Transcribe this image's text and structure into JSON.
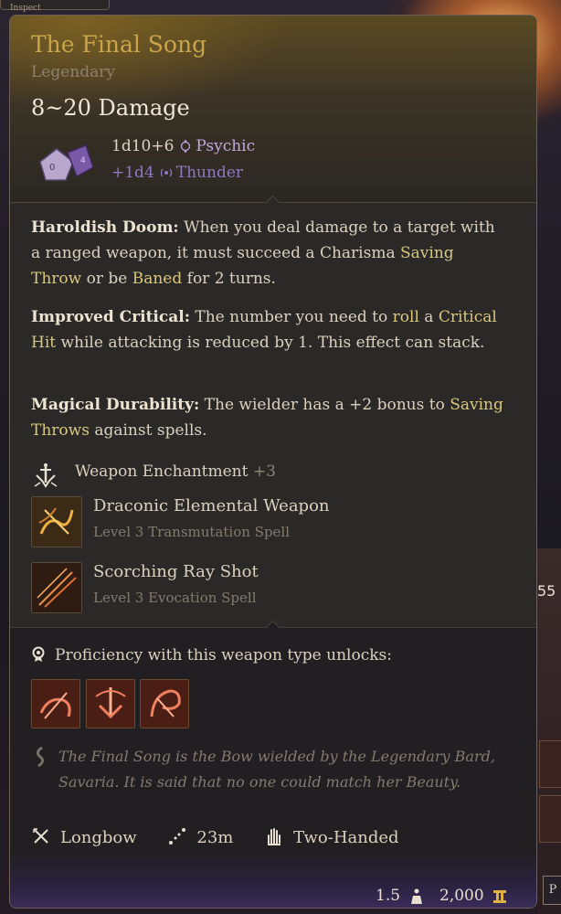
{
  "top_tab": {
    "label": "Inspect"
  },
  "side": {
    "number": "55",
    "bottom_button": "P"
  },
  "item": {
    "name": "The Final Song",
    "rarity": "Legendary",
    "damage": "8~20 Damage",
    "dice": [
      {
        "dice": "1d10+6",
        "type": "Psychic",
        "color": "#c6a8de"
      },
      {
        "dice": "+1d4",
        "type": "Thunder",
        "color": "#8f78c2"
      }
    ]
  },
  "passives": [
    {
      "name": "Haroldish Doom:",
      "t1": " When you deal damage to a target with a ranged weapon, it must succeed a Charisma ",
      "kw1": "Saving Throw",
      "t2": " or be ",
      "kw2": "Baned",
      "t3": " for 2 turns."
    },
    {
      "name": "Improved Critical:",
      "t1": " The number you need to ",
      "kw1": "roll",
      "t2": " a ",
      "kw2": "Critical Hit",
      "t3": " while attacking is reduced by 1. This effect can stack."
    },
    {
      "name": "Magical Durability:",
      "t1": " The wielder has a +2 bonus to ",
      "kw1": "Saving Throws",
      "t2": " against spells.",
      "kw2": "",
      "t3": ""
    }
  ],
  "enchantment": {
    "label": "Weapon Enchantment",
    "bonus": "+3"
  },
  "spells": [
    {
      "name": "Draconic Elemental Weapon",
      "sub": "Level 3 Transmutation Spell"
    },
    {
      "name": "Scorching Ray Shot",
      "sub": "Level 3 Evocation Spell"
    }
  ],
  "proficiency": {
    "label": "Proficiency with this weapon type unlocks:",
    "actions": [
      "action-1",
      "action-2",
      "action-3"
    ]
  },
  "flavor": "The Final Song is the Bow wielded by the Legendary Bard, Savaria. It is said that no one could match her Beauty.",
  "properties": [
    {
      "icon": "longbow-icon",
      "label": "Longbow"
    },
    {
      "icon": "range-icon",
      "label": "23m"
    },
    {
      "icon": "two-handed-icon",
      "label": "Two-Handed"
    }
  ],
  "footer": {
    "weight": "1.5",
    "price": "2,000"
  },
  "colors": {
    "title": "#c9a44a",
    "keyword": "#d9c77f",
    "psychic": "#c6a8de",
    "thunder": "#8f78c2"
  }
}
